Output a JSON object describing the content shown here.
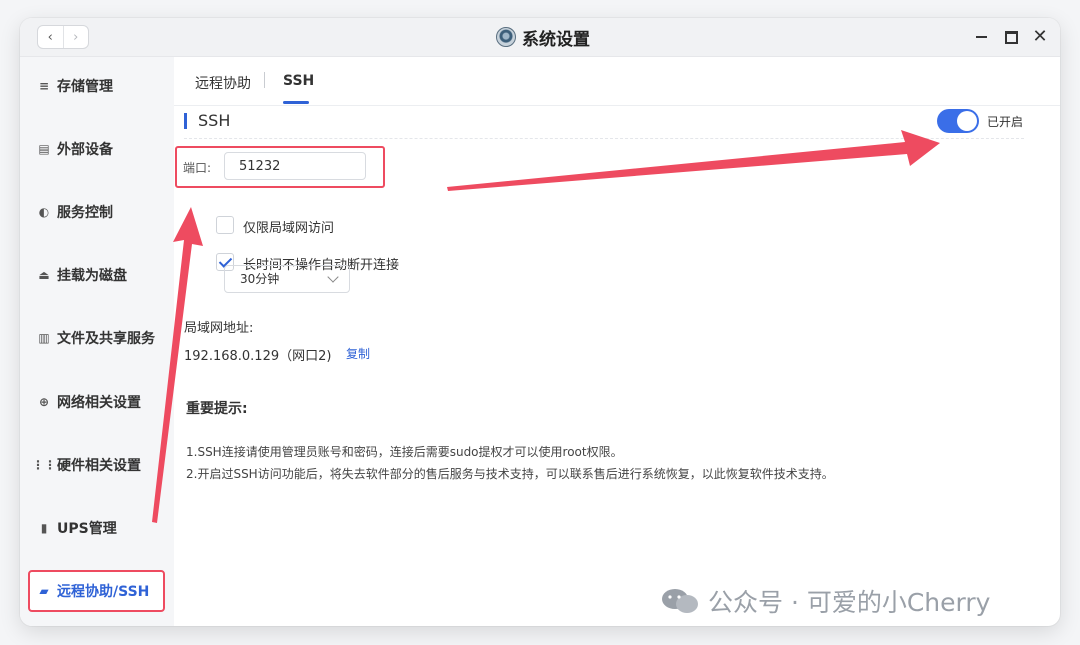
{
  "window": {
    "title": "系统设置",
    "nav_back": "‹",
    "nav_forward": "›"
  },
  "sidebar": {
    "items": [
      {
        "label": "存储管理",
        "icon": "database-icon"
      },
      {
        "label": "外部设备",
        "icon": "device-icon"
      },
      {
        "label": "服务控制",
        "icon": "toggle-icon"
      },
      {
        "label": "挂载为磁盘",
        "icon": "disk-icon"
      },
      {
        "label": "文件及共享服务",
        "icon": "file-icon"
      },
      {
        "label": "网络相关设置",
        "icon": "globe-icon"
      },
      {
        "label": "硬件相关设置",
        "icon": "grid-icon"
      },
      {
        "label": "UPS管理",
        "icon": "battery-icon"
      },
      {
        "label": "远程协助/SSH",
        "icon": "remote-icon",
        "active": true
      }
    ]
  },
  "tabs": {
    "remote_assist": "远程协助",
    "ssh": "SSH"
  },
  "ssh": {
    "section_title": "SSH",
    "toggle_label": "已开启",
    "toggle_on": true,
    "port_label": "端口:",
    "port_value": "51232",
    "lan_only_label": "仅限局域网访问",
    "lan_only_checked": false,
    "auto_disconnect_label": "长时间不操作自动断开连接",
    "auto_disconnect_checked": true,
    "timeout_value": "30分钟",
    "lan_address_label": "局域网地址:",
    "lan_address_value": "192.168.0.129（网口2)",
    "copy_label": "复制"
  },
  "notice": {
    "title": "重要提示:",
    "line1": "1.SSH连接请使用管理员账号和密码，连接后需要sudo提权才可以使用root权限。",
    "line2": "2.开启过SSH访问功能后，将失去软件部分的售后服务与技术支持，可以联系售后进行系统恢复，以此恢复软件技术支持。"
  },
  "watermark": {
    "text": "公众号 · 可爱的小Cherry"
  },
  "colors": {
    "accent": "#2f62d6",
    "annotation": "#ee4b60",
    "toggle": "#3a6ee8"
  }
}
